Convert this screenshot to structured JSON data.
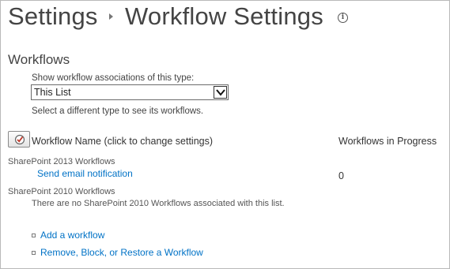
{
  "header": {
    "breadcrumb_root": "Settings",
    "page_title": "Workflow Settings"
  },
  "section": {
    "title": "Workflows"
  },
  "association": {
    "label": "Show workflow associations of this type:",
    "selected_type": "This List",
    "hint": "Select a different type to see its workflows."
  },
  "table": {
    "col_name": "Workflow Name (click to change settings)",
    "col_progress": "Workflows in Progress",
    "groups": [
      {
        "name": "SharePoint 2013 Workflows",
        "workflows": [
          {
            "name": "Send email notification",
            "in_progress": "0"
          }
        ]
      },
      {
        "name": "SharePoint 2010 Workflows",
        "empty_message": "There are no SharePoint 2010 Workflows associated with this list."
      }
    ]
  },
  "actions": {
    "add": "Add a workflow",
    "remove": "Remove, Block, or Restore a Workflow"
  },
  "icons": {
    "info": "info-icon",
    "dropdown": "chevron-down-icon",
    "settings_button": "workflow-settings-icon"
  },
  "colors": {
    "link": "#0072c6",
    "text": "#444444"
  }
}
